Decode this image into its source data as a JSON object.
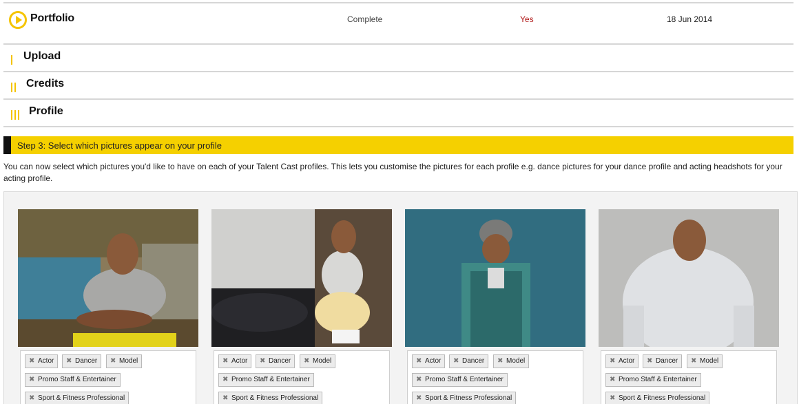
{
  "portfolio": {
    "title": "Portfolio",
    "status": "Complete",
    "verified": "Yes",
    "date": "18 Jun 2014",
    "icon": "play-circle-icon",
    "accent": "#f5c400",
    "verified_color": "#b01818"
  },
  "sections": [
    {
      "label": "Upload",
      "bars": 1
    },
    {
      "label": "Credits",
      "bars": 2
    },
    {
      "label": "Profile",
      "bars": 3
    }
  ],
  "step": {
    "text": "Step 3: Select which pictures appear on your profile",
    "bg_color": "#f5d000"
  },
  "intro": "You can now select which pictures you'd like to have on each of your Talent Cast profiles. This lets you customise the pictures for each profile e.g. dance pictures for your dance profile and acting headshots for your acting profile.",
  "remove_icon": "✖",
  "photos": [
    {
      "description": "man in grey t-shirt crouching by a wall",
      "tags": [
        "Actor",
        "Dancer",
        "Model",
        "Promo Staff & Entertainer",
        "Sport & Fitness Professional"
      ]
    },
    {
      "description": "man sitting by a car and brick wall",
      "tags": [
        "Actor",
        "Dancer",
        "Model",
        "Promo Staff & Entertainer",
        "Sport & Fitness Professional"
      ]
    },
    {
      "description": "man in beanie and check shirt by a wall",
      "tags": [
        "Actor",
        "Dancer",
        "Model",
        "Promo Staff & Entertainer",
        "Sport & Fitness Professional"
      ]
    },
    {
      "description": "man in grey hoodie smiling",
      "tags": [
        "Actor",
        "Dancer",
        "Model",
        "Promo Staff & Entertainer",
        "Sport & Fitness Professional"
      ]
    }
  ]
}
